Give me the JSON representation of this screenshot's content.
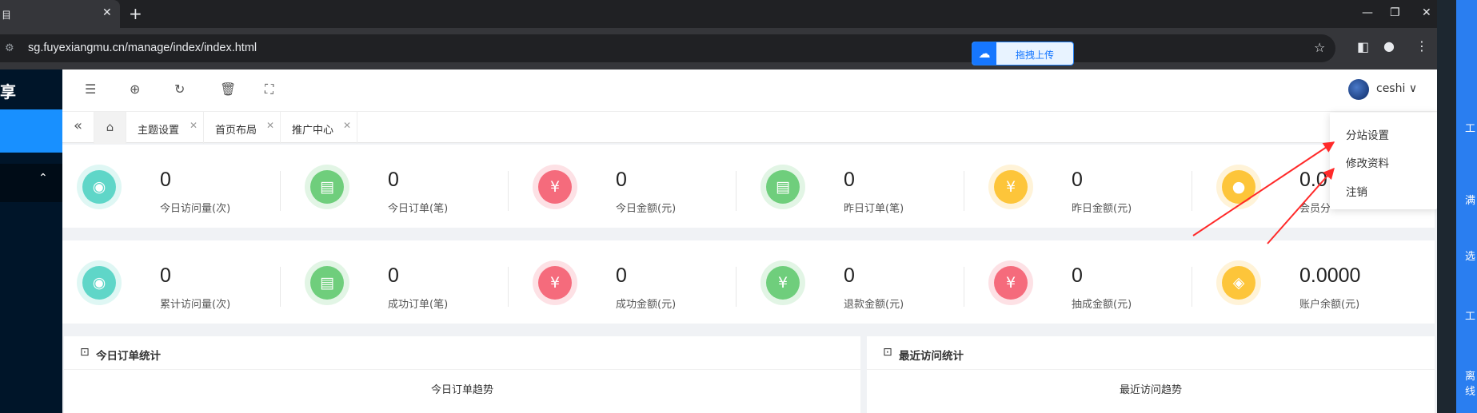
{
  "browser": {
    "tab_title": "目",
    "tab_close": "✕",
    "new_tab": "+",
    "window_controls": {
      "minimize": "—",
      "restore": "❐",
      "close": "✕"
    },
    "url": "sg.fuyexiangmu.cn/manage/index/index.html",
    "extension_chip": {
      "logo_icon": "baidu-netdisk-icon",
      "logo_glyph": "☁",
      "label": "拖拽上传"
    },
    "toolbar_icons": [
      "site-info-icon",
      "bookmark-star-icon",
      "side-panel-icon",
      "profile-icon",
      "menu-icon"
    ]
  },
  "sidebar": {
    "logo_text": "享",
    "group_chevron": "⌃"
  },
  "header": {
    "icons": [
      "menu-fold-icon",
      "globe-icon",
      "refresh-icon",
      "trash-icon",
      "fullscreen-icon"
    ],
    "user": {
      "name": "ceshi",
      "chevron": "∨"
    }
  },
  "tabs": {
    "left_arrow": "«",
    "home_glyph": "⌂",
    "items": [
      {
        "label": "主题设置",
        "close": "✕"
      },
      {
        "label": "首页布局",
        "close": "✕"
      },
      {
        "label": "推广中心",
        "close": "✕"
      }
    ]
  },
  "stats_row1": [
    {
      "value": "0",
      "label": "今日访问量(次)",
      "icon": "eye-icon",
      "glyph": "◉",
      "color": "#5fd6c8"
    },
    {
      "value": "0",
      "label": "今日订单(笔)",
      "icon": "calendar-icon",
      "glyph": "▤",
      "color": "#6fce7c"
    },
    {
      "value": "0",
      "label": "今日金额(元)",
      "icon": "yen-icon",
      "glyph": "¥",
      "color": "#f56b7c"
    },
    {
      "value": "0",
      "label": "昨日订单(笔)",
      "icon": "calendar-icon",
      "glyph": "▤",
      "color": "#6fce7c"
    },
    {
      "value": "0",
      "label": "昨日金额(元)",
      "icon": "yen-icon",
      "glyph": "¥",
      "color": "#fdc53a"
    },
    {
      "value": "0.0",
      "label": "会员分",
      "icon": "user-icon",
      "glyph": "●",
      "color": "#fdc53a"
    }
  ],
  "stats_row2": [
    {
      "value": "0",
      "label": "累计访问量(次)",
      "icon": "eye-icon",
      "glyph": "◉",
      "color": "#5fd6c8"
    },
    {
      "value": "0",
      "label": "成功订单(笔)",
      "icon": "calendar-icon",
      "glyph": "▤",
      "color": "#6fce7c"
    },
    {
      "value": "0",
      "label": "成功金额(元)",
      "icon": "yen-icon",
      "glyph": "¥",
      "color": "#f56b7c"
    },
    {
      "value": "0",
      "label": "退款金额(元)",
      "icon": "yen-icon",
      "glyph": "¥",
      "color": "#6fce7c"
    },
    {
      "value": "0",
      "label": "抽成金额(元)",
      "icon": "yen-icon",
      "glyph": "¥",
      "color": "#f56b7c"
    },
    {
      "value": "0.0000",
      "label": "账户余额(元)",
      "icon": "tag-icon",
      "glyph": "◈",
      "color": "#fdc53a"
    }
  ],
  "panels": [
    {
      "title": "今日订单统计",
      "subtitle": "今日订单趋势",
      "icon": "chart-board-icon"
    },
    {
      "title": "最近访问统计",
      "subtitle": "最近访问趋势",
      "icon": "chart-board-icon"
    }
  ],
  "dropdown": {
    "items": [
      "分站设置",
      "修改资料",
      "注销"
    ]
  },
  "annotation": {
    "arrow_color": "#ff2a2a"
  },
  "rightbar": {
    "labels": [
      "工",
      "满",
      "选",
      "工",
      "离线"
    ]
  }
}
